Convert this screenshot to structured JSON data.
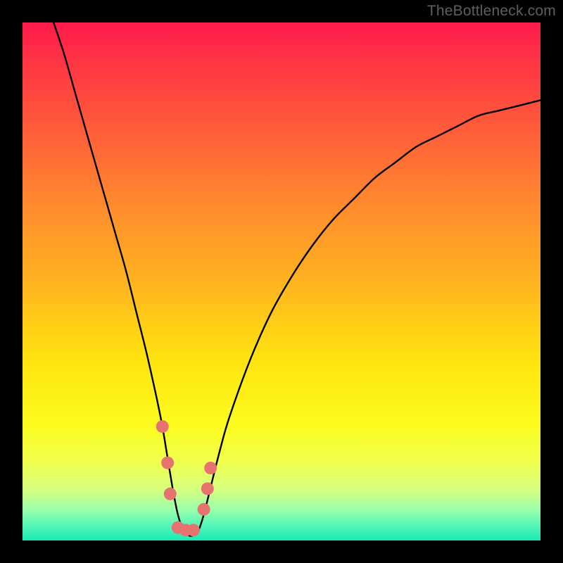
{
  "watermark": "TheBottleneck.com",
  "chart_data": {
    "type": "line",
    "title": "",
    "xlabel": "",
    "ylabel": "",
    "xlim": [
      0,
      100
    ],
    "ylim": [
      0,
      100
    ],
    "series": [
      {
        "name": "bottleneck-curve",
        "x": [
          6,
          8,
          10,
          12,
          14,
          16,
          18,
          20,
          22,
          24,
          26,
          27,
          28,
          29,
          30,
          31,
          32,
          33,
          34,
          35,
          36,
          38,
          40,
          44,
          48,
          52,
          56,
          60,
          64,
          68,
          72,
          76,
          80,
          84,
          88,
          92,
          96,
          100
        ],
        "y": [
          100,
          94,
          87,
          80,
          73,
          66,
          59,
          52,
          44,
          36,
          27,
          22,
          16,
          10,
          5,
          2,
          1,
          1,
          2,
          5,
          9,
          17,
          24,
          35,
          44,
          51,
          57,
          62,
          66,
          70,
          73,
          76,
          78,
          80,
          82,
          83,
          84,
          85
        ]
      }
    ],
    "markers": [
      {
        "x": 27.0,
        "y": 22
      },
      {
        "x": 28.0,
        "y": 15
      },
      {
        "x": 28.5,
        "y": 9
      },
      {
        "x": 30.0,
        "y": 2.5
      },
      {
        "x": 31.5,
        "y": 2.0
      },
      {
        "x": 33.0,
        "y": 2.0
      },
      {
        "x": 35.0,
        "y": 6
      },
      {
        "x": 35.7,
        "y": 10
      },
      {
        "x": 36.3,
        "y": 14
      }
    ],
    "marker_color": "#e6736f",
    "curve_color": "#000000",
    "background_gradient": [
      "#ff1a4b",
      "#ffe30f",
      "#18e9b6"
    ]
  }
}
